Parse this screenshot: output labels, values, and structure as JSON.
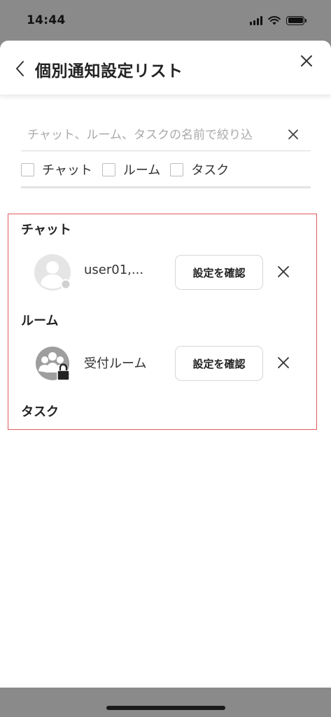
{
  "status_bar": {
    "time": "14:44"
  },
  "header": {
    "title": "個別通知設定リスト",
    "back_icon": "chevron-left-icon",
    "close_icon": "close-icon"
  },
  "search": {
    "placeholder": "チャット、ルーム、タスクの名前で絞り込",
    "value": ""
  },
  "filters": [
    {
      "label": "チャット",
      "checked": false
    },
    {
      "label": "ルーム",
      "checked": false
    },
    {
      "label": "タスク",
      "checked": false
    }
  ],
  "results": {
    "chat": {
      "heading": "チャット",
      "items": [
        {
          "name": "user01,...",
          "button_label": "設定を確認",
          "avatar_icon": "user-avatar-icon"
        }
      ]
    },
    "room": {
      "heading": "ルーム",
      "items": [
        {
          "name": "受付ルーム",
          "button_label": "設定を確認",
          "avatar_icon": "group-locked-avatar-icon"
        }
      ]
    },
    "task": {
      "heading": "タスク",
      "items": []
    }
  },
  "colors": {
    "highlight_border": "#e4595c",
    "background_dim": "#8a8a8a"
  }
}
